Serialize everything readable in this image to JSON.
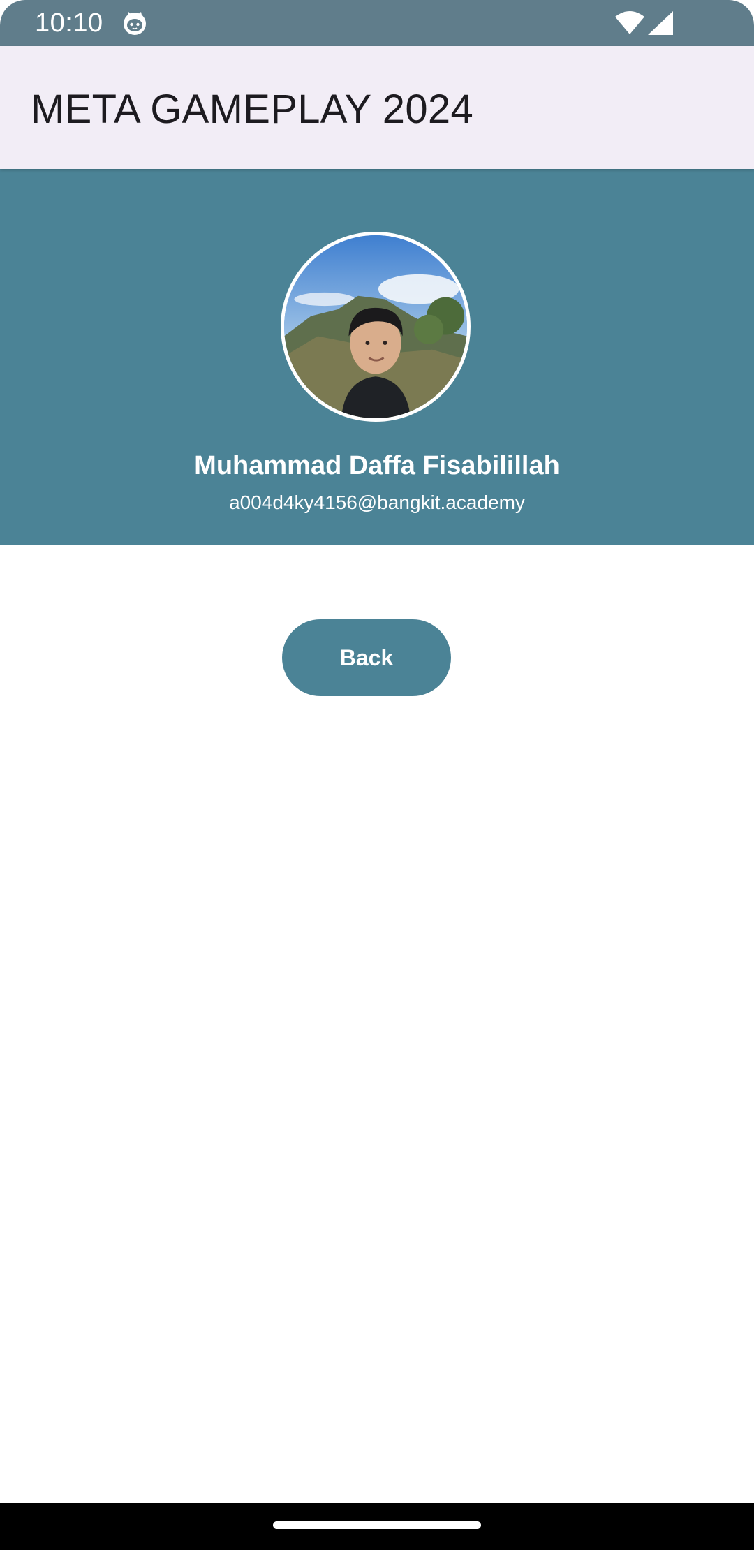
{
  "status_bar": {
    "time": "10:10",
    "app_icon": "cat-face-icon",
    "wifi_icon": "wifi-icon",
    "signal_icon": "cellular-signal-icon",
    "background": "#607d8b"
  },
  "app_bar": {
    "title": "META GAMEPLAY 2024",
    "background": "#f2edf6"
  },
  "profile": {
    "avatar": "profile-photo",
    "name": "Muhammad Daffa Fisabilillah",
    "email": "a004d4ky4156@bangkit.academy",
    "header_color": "#4b8396"
  },
  "actions": {
    "back_label": "Back",
    "button_color": "#4b8396"
  },
  "navigation": {
    "handle": "gesture-handle"
  }
}
